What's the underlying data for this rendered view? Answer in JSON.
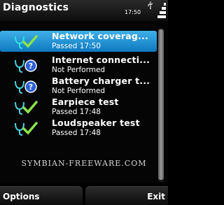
{
  "titlebar": {
    "title": "Diagnostics",
    "time": "17:50",
    "icons": [
      "usb-icon",
      "signal-strength-icon"
    ]
  },
  "tests": [
    {
      "name": "Network coverag...",
      "status": "Passed 17:50",
      "state": "passed",
      "icon": "check-icon",
      "selected": true
    },
    {
      "name": "Internet connecti...",
      "status": "Not Performed",
      "state": "not-performed",
      "icon": "question-icon",
      "selected": false
    },
    {
      "name": "Battery charger t...",
      "status": "Not Performed",
      "state": "not-performed",
      "icon": "question-icon",
      "selected": false
    },
    {
      "name": "Earpiece test",
      "status": "Passed 17:48",
      "state": "passed",
      "icon": "check-icon",
      "selected": false
    },
    {
      "name": "Loudspeaker test",
      "status": "Passed 17:48",
      "state": "passed",
      "icon": "check-icon",
      "selected": false
    }
  ],
  "watermark": "SYMBIAN-FREEWARE.COM",
  "softkeys": {
    "left": "Options",
    "right": "Exit"
  },
  "colors": {
    "selection": "#1e96d8",
    "passed_check": "#8ce34a",
    "stethoscope": "#4ad2e0",
    "question_badge": "#2a5fd6"
  }
}
